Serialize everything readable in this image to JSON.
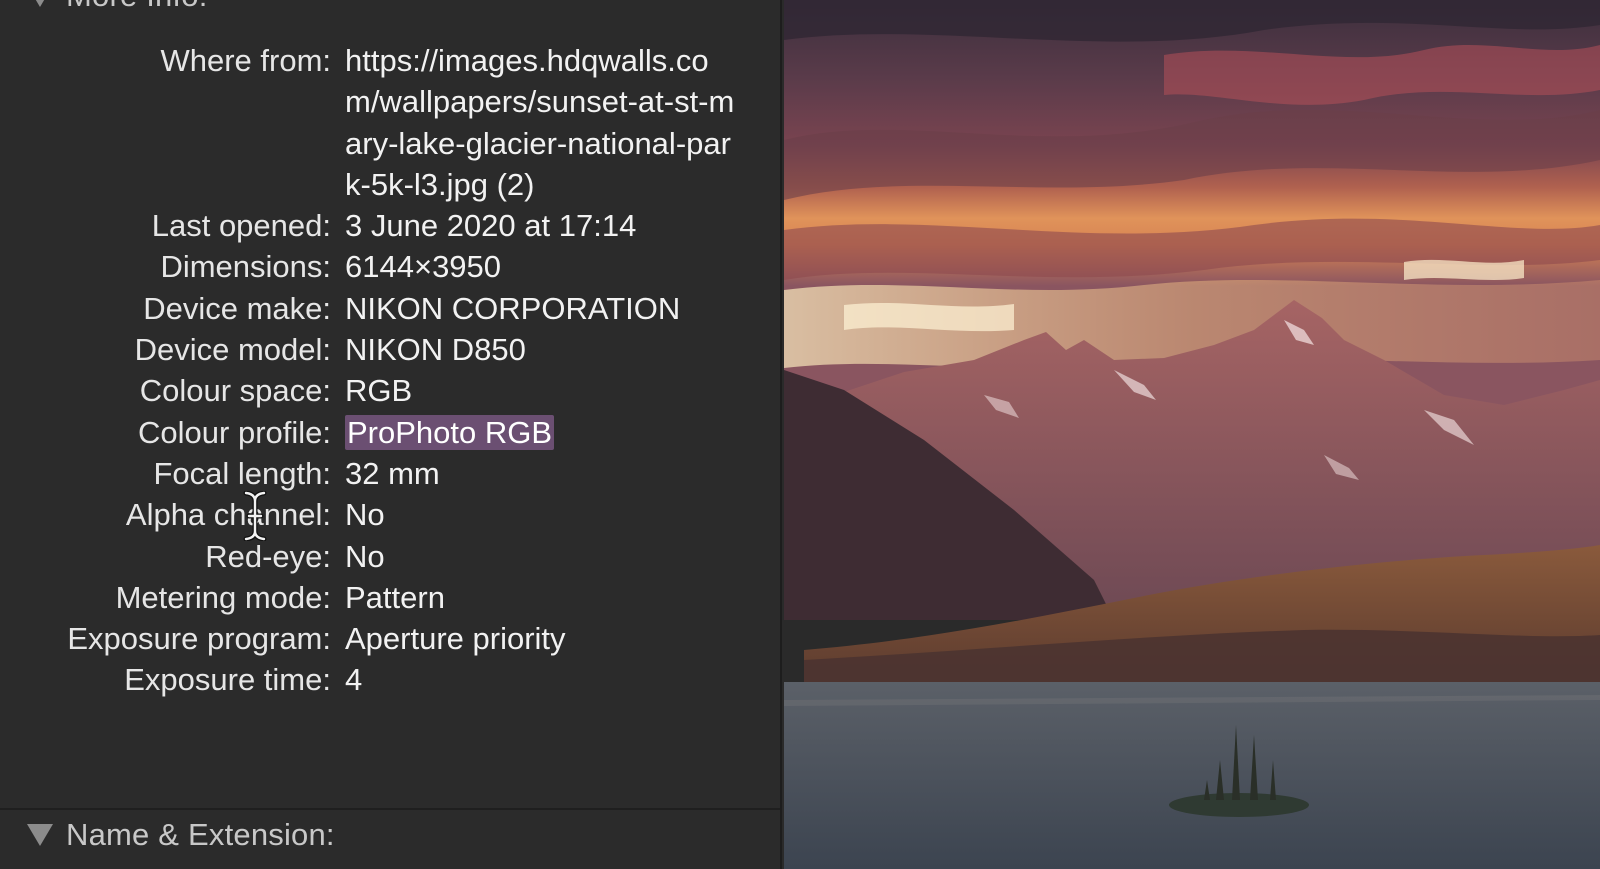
{
  "more_info": {
    "header_label": "More Info:",
    "rows": [
      {
        "label": "Where from:",
        "value": "https://images.hdqwalls.com/wallpapers/sunset-at-st-mary-lake-glacier-national-park-5k-l3.jpg (2)"
      },
      {
        "label": "Last opened:",
        "value": "3 June 2020 at 17:14"
      },
      {
        "label": "Dimensions:",
        "value": "6144×3950"
      },
      {
        "label": "Device make:",
        "value": "NIKON CORPORATION"
      },
      {
        "label": "Device model:",
        "value": "NIKON D850"
      },
      {
        "label": "Colour space:",
        "value": "RGB"
      },
      {
        "label": "Colour profile:",
        "value": "ProPhoto RGB"
      },
      {
        "label": "Focal length:",
        "value": "32 mm"
      },
      {
        "label": "Alpha channel:",
        "value": "No"
      },
      {
        "label": "Red-eye:",
        "value": "No"
      },
      {
        "label": "Metering mode:",
        "value": "Pattern"
      },
      {
        "label": "Exposure program:",
        "value": "Aperture priority"
      },
      {
        "label": "Exposure time:",
        "value": "4"
      }
    ]
  },
  "name_extension": {
    "header_label": "Name & Extension:"
  },
  "colors": {
    "selection_highlight": "#6b4f72",
    "panel_background": "#2b2b2b"
  },
  "icons": {
    "disclosure": "disclosure-triangle-icon",
    "cursor": "text-cursor-icon"
  }
}
